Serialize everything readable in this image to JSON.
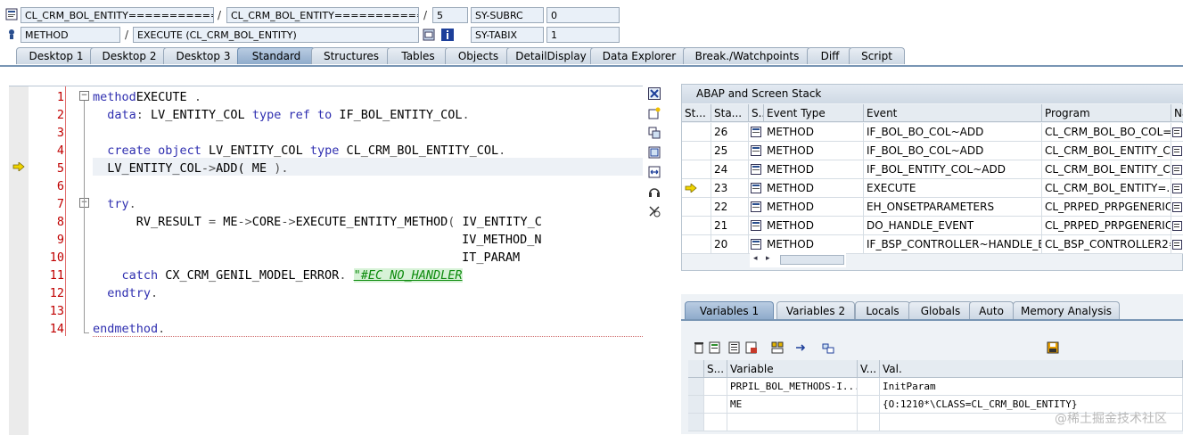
{
  "header": {
    "row1": {
      "class_field": "CL_CRM_BOL_ENTITY=============...",
      "sep1": "/",
      "program_field": "CL_CRM_BOL_ENTITY=============...",
      "sep2": "/",
      "line_field": "5",
      "sysvar_name": "SY-SUBRC",
      "sysvar_value": "0"
    },
    "row2": {
      "type_field": "METHOD",
      "sep1": "/",
      "method_field": "EXECUTE (CL_CRM_BOL_ENTITY)",
      "sysvar_name": "SY-TABIX",
      "sysvar_value": "1"
    }
  },
  "tabs": [
    "Desktop 1",
    "Desktop 2",
    "Desktop 3",
    "Standard",
    "Structures",
    "Tables",
    "Objects",
    "DetailDisplay",
    "Data Explorer",
    "Break./Watchpoints",
    "Diff",
    "Script"
  ],
  "active_tab": "Standard",
  "editor": {
    "lines": [
      {
        "n": "1",
        "segs": [
          [
            "kw",
            "method"
          ],
          [
            "",
            "EXECUTE "
          ],
          [
            "op",
            "."
          ]
        ]
      },
      {
        "n": "2",
        "segs": [
          [
            "kw",
            "data"
          ],
          [
            "op",
            ": "
          ],
          [
            "",
            "LV_ENTITY_COL "
          ],
          [
            "kw",
            "type ref to "
          ],
          [
            "",
            "IF_BOL_ENTITY_COL"
          ],
          [
            "op",
            "."
          ]
        ]
      },
      {
        "n": "3",
        "segs": []
      },
      {
        "n": "4",
        "segs": [
          [
            "kw",
            "create object "
          ],
          [
            "",
            "LV_ENTITY_COL "
          ],
          [
            "kw",
            "type "
          ],
          [
            "",
            "CL_CRM_BOL_ENTITY_COL"
          ],
          [
            "op",
            "."
          ]
        ]
      },
      {
        "n": "5",
        "segs": [
          [
            "",
            "LV_ENTITY_COL"
          ],
          [
            "op",
            "->"
          ],
          [
            "",
            "ADD( ME "
          ],
          [
            "op",
            ")."
          ]
        ]
      },
      {
        "n": "6",
        "segs": []
      },
      {
        "n": "7",
        "segs": [
          [
            "kw",
            "try"
          ],
          [
            "op",
            "."
          ]
        ]
      },
      {
        "n": "8",
        "segs": [
          [
            "",
            "RV_RESULT "
          ],
          [
            "op",
            "= "
          ],
          [
            "",
            "ME"
          ],
          [
            "op",
            "->"
          ],
          [
            "",
            "CORE"
          ],
          [
            "op",
            "->"
          ],
          [
            "",
            "EXECUTE_ENTITY_METHOD"
          ],
          [
            "op",
            "( "
          ],
          [
            "",
            "IV_ENTITY_C"
          ]
        ]
      },
      {
        "n": "9",
        "segs": [
          [
            "",
            "IV_METHOD_N"
          ]
        ]
      },
      {
        "n": "10",
        "segs": [
          [
            "",
            "IT_PARAM"
          ]
        ]
      },
      {
        "n": "11",
        "segs": [
          [
            "kw",
            "catch "
          ],
          [
            "",
            "CX_CRM_GENIL_MODEL_ERROR"
          ],
          [
            "op",
            ". "
          ],
          [
            "com",
            "\"#EC NO_HANDLER"
          ]
        ]
      },
      {
        "n": "12",
        "segs": [
          [
            "kw",
            "endtry"
          ],
          [
            "op",
            "."
          ]
        ]
      },
      {
        "n": "13",
        "segs": []
      },
      {
        "n": "14",
        "segs": [
          [
            "kw",
            "endmethod"
          ],
          [
            "op",
            "."
          ]
        ]
      }
    ],
    "current_line": "5"
  },
  "stack": {
    "title": "ABAP and Screen Stack",
    "columns": [
      "St...",
      "Sta...",
      "S...",
      "Event Type",
      "Event",
      "Program",
      "Na"
    ],
    "rows": [
      {
        "level": "26",
        "type": "METHOD",
        "event": "IF_BOL_BO_COL~ADD",
        "program": "CL_CRM_BOL_BO_COL=..."
      },
      {
        "level": "25",
        "type": "METHOD",
        "event": "IF_BOL_BO_COL~ADD",
        "program": "CL_CRM_BOL_ENTITY_C..."
      },
      {
        "level": "24",
        "type": "METHOD",
        "event": "IF_BOL_ENTITY_COL~ADD",
        "program": "CL_CRM_BOL_ENTITY_C..."
      },
      {
        "level": "23",
        "type": "METHOD",
        "event": "EXECUTE",
        "program": "CL_CRM_BOL_ENTITY=..."
      },
      {
        "level": "22",
        "type": "METHOD",
        "event": "EH_ONSETPARAMETERS",
        "program": "CL_PRPED_PRPGENERIC..."
      },
      {
        "level": "21",
        "type": "METHOD",
        "event": "DO_HANDLE_EVENT",
        "program": "CL_PRPED_PRPGENERIC..."
      },
      {
        "level": "20",
        "type": "METHOD",
        "event": "IF_BSP_CONTROLLER~HANDLE_E...",
        "program": "CL_BSP_CONTROLLER2=..."
      }
    ]
  },
  "var_tabs": [
    "Variables 1",
    "Variables 2",
    "Locals",
    "Globals",
    "Auto",
    "Memory Analysis"
  ],
  "active_var_tab": "Variables 1",
  "vars": {
    "columns": [
      "S...",
      "Variable",
      "V...",
      "Val."
    ],
    "rows": [
      {
        "name": "PRPIL_BOL_METHODS-I...",
        "value": "InitParam"
      },
      {
        "name": "ME",
        "value": "{O:1210*\\CLASS=CL_CRM_BOL_ENTITY}"
      }
    ]
  },
  "watermark": "@稀土掘金技术社区"
}
